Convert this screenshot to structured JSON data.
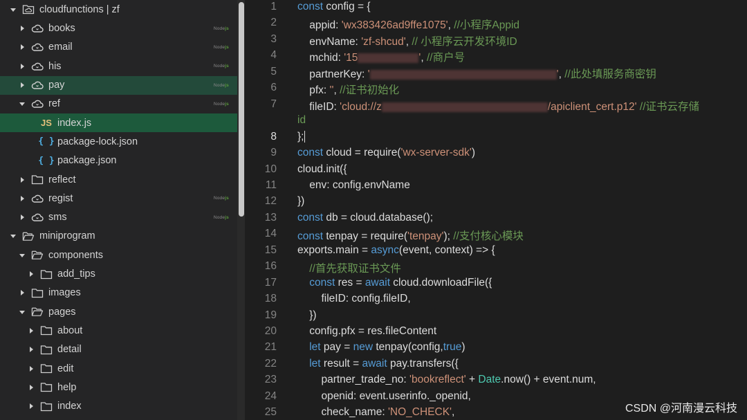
{
  "explorer": {
    "items": [
      {
        "label": "cloudfunctions | zf",
        "depth": 0,
        "chevron": "down",
        "icon": "cloud-folder-icon",
        "nodejs": false
      },
      {
        "label": "books",
        "depth": 1,
        "chevron": "right",
        "icon": "cloud-icon",
        "nodejs": true
      },
      {
        "label": "email",
        "depth": 1,
        "chevron": "right",
        "icon": "cloud-icon",
        "nodejs": true
      },
      {
        "label": "his",
        "depth": 1,
        "chevron": "right",
        "icon": "cloud-icon",
        "nodejs": true
      },
      {
        "label": "pay",
        "depth": 1,
        "chevron": "right",
        "icon": "cloud-icon",
        "nodejs": true,
        "highlight": "pay"
      },
      {
        "label": "ref",
        "depth": 1,
        "chevron": "down",
        "icon": "cloud-icon",
        "nodejs": true
      },
      {
        "label": "index.js",
        "depth": 2,
        "chevron": "",
        "icon": "js-file-icon",
        "nodejs": false,
        "highlight": "index"
      },
      {
        "label": "package-lock.json",
        "depth": 2,
        "chevron": "",
        "icon": "json-file-icon",
        "nodejs": false
      },
      {
        "label": "package.json",
        "depth": 2,
        "chevron": "",
        "icon": "json-file-icon",
        "nodejs": false
      },
      {
        "label": "reflect",
        "depth": 1,
        "chevron": "right",
        "icon": "folder-icon",
        "nodejs": false
      },
      {
        "label": "regist",
        "depth": 1,
        "chevron": "right",
        "icon": "cloud-icon",
        "nodejs": true
      },
      {
        "label": "sms",
        "depth": 1,
        "chevron": "right",
        "icon": "cloud-icon",
        "nodejs": true
      },
      {
        "label": "miniprogram",
        "depth": 0,
        "chevron": "down",
        "icon": "folder-open-icon",
        "nodejs": false
      },
      {
        "label": "components",
        "depth": 1,
        "chevron": "down",
        "icon": "folder-open-icon",
        "nodejs": false
      },
      {
        "label": "add_tips",
        "depth": 2,
        "chevron": "right",
        "icon": "folder-icon",
        "nodejs": false
      },
      {
        "label": "images",
        "depth": 1,
        "chevron": "right",
        "icon": "folder-icon",
        "nodejs": false
      },
      {
        "label": "pages",
        "depth": 1,
        "chevron": "down",
        "icon": "folder-open-icon",
        "nodejs": false
      },
      {
        "label": "about",
        "depth": 2,
        "chevron": "right",
        "icon": "folder-icon",
        "nodejs": false
      },
      {
        "label": "detail",
        "depth": 2,
        "chevron": "right",
        "icon": "folder-icon",
        "nodejs": false
      },
      {
        "label": "edit",
        "depth": 2,
        "chevron": "right",
        "icon": "folder-icon",
        "nodejs": false
      },
      {
        "label": "help",
        "depth": 2,
        "chevron": "right",
        "icon": "folder-icon",
        "nodejs": false
      },
      {
        "label": "index",
        "depth": 2,
        "chevron": "right",
        "icon": "folder-icon",
        "nodejs": false
      }
    ],
    "nodejs_badge": {
      "prefix": "Node",
      "suffix": "js"
    }
  },
  "editor": {
    "current_line": 8,
    "lines": [
      {
        "n": "1",
        "segs": [
          [
            "k",
            "const"
          ],
          [
            "p",
            " config = {"
          ]
        ]
      },
      {
        "n": "2",
        "segs": [
          [
            "p",
            "    appid: "
          ],
          [
            "s",
            "'wx383426ad9ffe1075'"
          ],
          [
            "p",
            ", "
          ],
          [
            "c",
            "//小程序Appid"
          ]
        ]
      },
      {
        "n": "3",
        "segs": [
          [
            "p",
            "    envName: "
          ],
          [
            "s",
            "'zf-shcud'"
          ],
          [
            "p",
            ", "
          ],
          [
            "c",
            "// 小程序云开发环境ID"
          ]
        ]
      },
      {
        "n": "4",
        "segs": [
          [
            "p",
            "    mchid: "
          ],
          [
            "s",
            "'15"
          ],
          [
            "r",
            "88"
          ],
          [
            "s",
            "'"
          ],
          [
            "p",
            ", "
          ],
          [
            "c",
            "//商户号"
          ]
        ]
      },
      {
        "n": "5",
        "segs": [
          [
            "p",
            "    partnerKey: "
          ],
          [
            "s",
            "'"
          ],
          [
            "r",
            "270"
          ],
          [
            "s",
            "'"
          ],
          [
            "p",
            ", "
          ],
          [
            "c",
            "//此处填服务商密钥"
          ]
        ]
      },
      {
        "n": "6",
        "segs": [
          [
            "p",
            "    pfx: "
          ],
          [
            "s",
            "''"
          ],
          [
            "p",
            ", "
          ],
          [
            "c",
            "//证书初始化"
          ]
        ]
      },
      {
        "n": "7",
        "segs": [
          [
            "p",
            "    fileID: "
          ],
          [
            "s",
            "'cloud://z"
          ],
          [
            "r",
            "240"
          ],
          [
            "s",
            "/apiclient_cert.p12'"
          ],
          [
            "p",
            " "
          ],
          [
            "c",
            "//证书云存储"
          ]
        ]
      },
      {
        "n": "",
        "segs": [
          [
            "c",
            "id"
          ]
        ]
      },
      {
        "n": "8",
        "segs": [
          [
            "p",
            "};"
          ],
          [
            "cur",
            ""
          ]
        ]
      },
      {
        "n": "9",
        "segs": [
          [
            "k",
            "const"
          ],
          [
            "p",
            " cloud = require("
          ],
          [
            "s",
            "'wx-server-sdk'"
          ],
          [
            "p",
            ")"
          ]
        ]
      },
      {
        "n": "10",
        "segs": [
          [
            "p",
            "cloud.init({"
          ]
        ]
      },
      {
        "n": "11",
        "segs": [
          [
            "p",
            "    env: config.envName"
          ]
        ]
      },
      {
        "n": "12",
        "segs": [
          [
            "p",
            "})"
          ]
        ]
      },
      {
        "n": "13",
        "segs": [
          [
            "k",
            "const"
          ],
          [
            "p",
            " db = cloud.database();"
          ]
        ]
      },
      {
        "n": "14",
        "segs": [
          [
            "k",
            "const"
          ],
          [
            "p",
            " tenpay = require("
          ],
          [
            "s",
            "'tenpay'"
          ],
          [
            "p",
            "); "
          ],
          [
            "c",
            "//支付核心模块"
          ]
        ]
      },
      {
        "n": "15",
        "segs": [
          [
            "p",
            "exports.main = "
          ],
          [
            "k",
            "async"
          ],
          [
            "p",
            "(event, context) => {"
          ]
        ]
      },
      {
        "n": "16",
        "segs": [
          [
            "p",
            "    "
          ],
          [
            "c",
            "//首先获取证书文件"
          ]
        ]
      },
      {
        "n": "17",
        "segs": [
          [
            "p",
            "    "
          ],
          [
            "k",
            "const"
          ],
          [
            "p",
            " res = "
          ],
          [
            "k",
            "await"
          ],
          [
            "p",
            " cloud.downloadFile({"
          ]
        ]
      },
      {
        "n": "18",
        "segs": [
          [
            "p",
            "        fileID: config.fileID,"
          ]
        ]
      },
      {
        "n": "19",
        "segs": [
          [
            "p",
            "    })"
          ]
        ]
      },
      {
        "n": "20",
        "segs": [
          [
            "p",
            "    config.pfx = res.fileContent"
          ]
        ]
      },
      {
        "n": "21",
        "segs": [
          [
            "p",
            "    "
          ],
          [
            "k",
            "let"
          ],
          [
            "p",
            " pay = "
          ],
          [
            "k",
            "new"
          ],
          [
            "p",
            " tenpay(config,"
          ],
          [
            "k",
            "true"
          ],
          [
            "p",
            ")"
          ]
        ]
      },
      {
        "n": "22",
        "segs": [
          [
            "p",
            "    "
          ],
          [
            "k",
            "let"
          ],
          [
            "p",
            " result = "
          ],
          [
            "k",
            "await"
          ],
          [
            "p",
            " pay.transfers({"
          ]
        ]
      },
      {
        "n": "23",
        "segs": [
          [
            "p",
            "        partner_trade_no: "
          ],
          [
            "s",
            "'bookreflect'"
          ],
          [
            "p",
            " + "
          ],
          [
            "t",
            "Date"
          ],
          [
            "p",
            ".now() + event.num,"
          ]
        ]
      },
      {
        "n": "24",
        "segs": [
          [
            "p",
            "        openid: event.userinfo._openid,"
          ]
        ]
      },
      {
        "n": "25",
        "segs": [
          [
            "p",
            "        check_name: "
          ],
          [
            "s",
            "'NO_CHECK'"
          ],
          [
            "p",
            ","
          ]
        ]
      }
    ]
  },
  "watermark": "CSDN @河南漫云科技"
}
